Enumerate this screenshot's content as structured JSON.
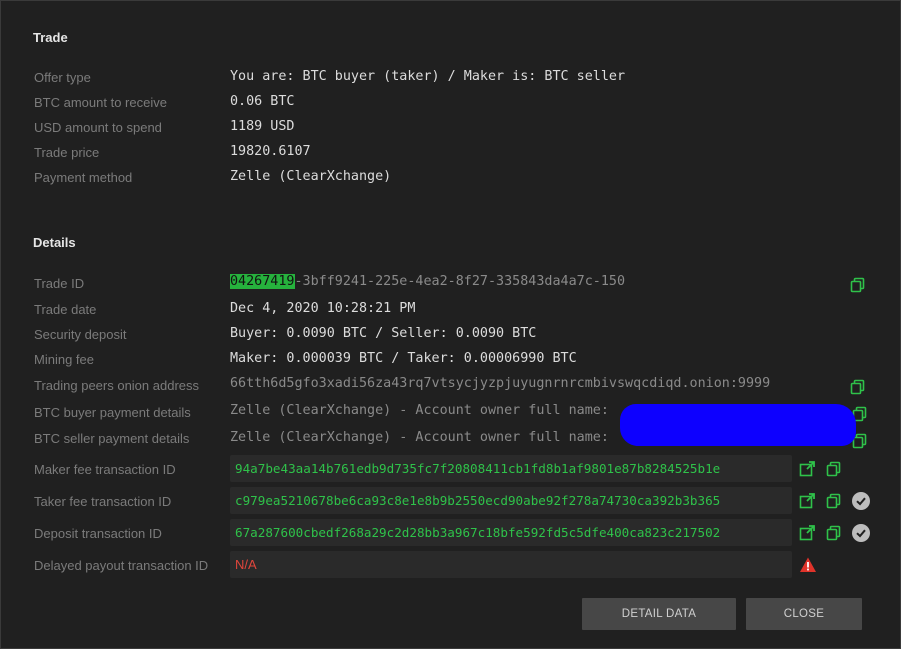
{
  "trade": {
    "section_title": "Trade",
    "rows": [
      {
        "label": "Offer type",
        "value": "You are: BTC buyer (taker) / Maker is: BTC seller"
      },
      {
        "label": "BTC amount to receive",
        "value": "0.06 BTC"
      },
      {
        "label": "USD amount to spend",
        "value": "1189 USD"
      },
      {
        "label": "Trade price",
        "value": "19820.6107"
      },
      {
        "label": "Payment method",
        "value": "Zelle (ClearXchange)"
      }
    ]
  },
  "details": {
    "section_title": "Details",
    "trade_id": {
      "label": "Trade ID",
      "highlight": "04267419",
      "rest": "-3bff9241-225e-4ea2-8f27-335843da4a7c-150"
    },
    "trade_date": {
      "label": "Trade date",
      "value": "Dec 4, 2020 10:28:21 PM"
    },
    "security_deposit": {
      "label": "Security deposit",
      "value": "Buyer: 0.0090 BTC / Seller: 0.0090 BTC"
    },
    "mining_fee": {
      "label": "Mining fee",
      "value": "Maker: 0.000039 BTC / Taker: 0.00006990 BTC"
    },
    "onion": {
      "label": "Trading peers onion address",
      "value": "66tth6d5gfo3xadi56za43rq7vtsycjyzpjuyugnrnrcmbivswqcdiqd.onion:9999"
    },
    "buyer_payment": {
      "label": "BTC buyer payment details",
      "value": "Zelle (ClearXchange) - Account owner full name:"
    },
    "seller_payment": {
      "label": "BTC seller payment details",
      "value": "Zelle (ClearXchange) - Account owner full name:"
    },
    "maker_fee_tx": {
      "label": "Maker fee transaction ID",
      "value": "94a7be43aa14b761edb9d735fc7f20808411cb1fd8b1af9801e87b8284525b1e"
    },
    "taker_fee_tx": {
      "label": "Taker fee transaction ID",
      "value": "c979ea5210678be6ca93c8e1e8b9b2550ecd90abe92f278a74730ca392b3b365"
    },
    "deposit_tx": {
      "label": "Deposit transaction ID",
      "value": "67a287600cbedf268a29c2d28bb3a967c18bfe592fd5c5dfe400ca823c217502"
    },
    "delayed_payout_tx": {
      "label": "Delayed payout transaction ID",
      "value": "N/A"
    }
  },
  "buttons": {
    "detail_data": "DETAIL DATA",
    "close": "CLOSE"
  },
  "icons": {
    "copy": "copy-icon",
    "open_external": "open-external-icon",
    "confirmed": "check-circle-icon",
    "warning": "warning-icon"
  },
  "colors": {
    "accent_green": "#2fc24a",
    "highlight_green": "#26b23d",
    "error_red": "#e0463c"
  }
}
